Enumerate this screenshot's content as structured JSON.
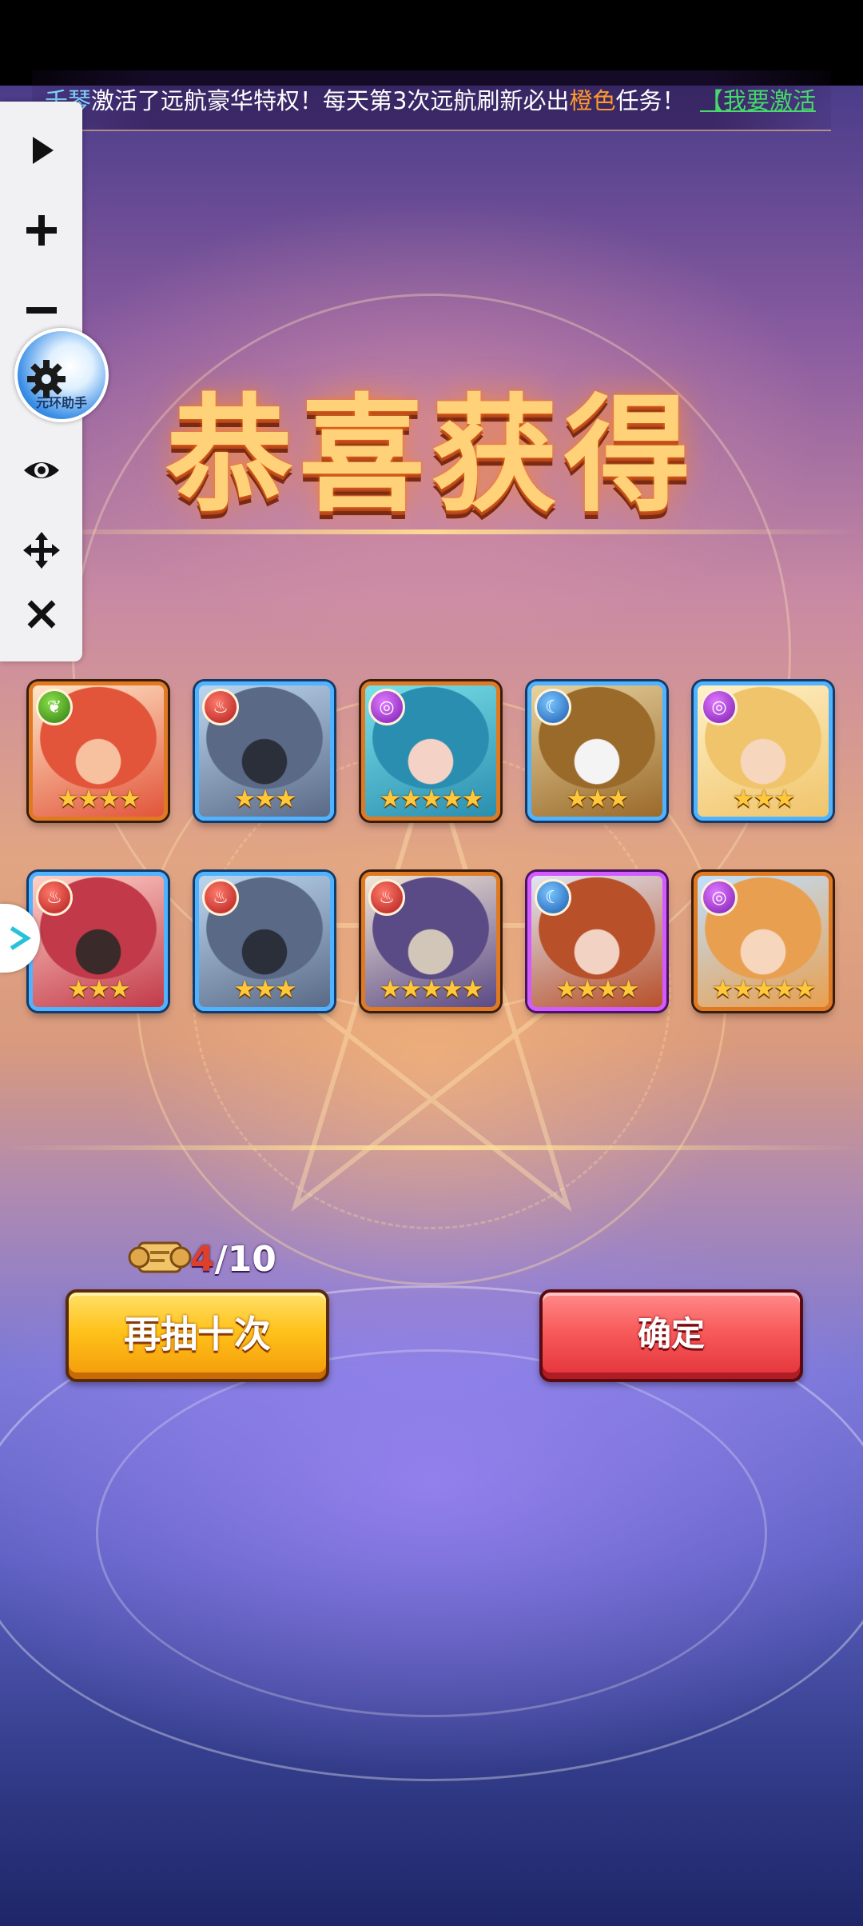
{
  "announcement": {
    "player_name": "千琴",
    "text_part1": "激活了远航豪华特权！每天第3次远航刷新必出",
    "highlight": "橙色",
    "text_part2": "任务！",
    "link_text": "【我要激活"
  },
  "title": "恭喜获得",
  "heroes": [
    {
      "faction": "nature",
      "faction_icon": "leaf-faction-icon",
      "frame": "orange",
      "stars": "★★★★",
      "star_count": 4,
      "portrait": "red-haired-heroine"
    },
    {
      "faction": "fire",
      "faction_icon": "flame-faction-icon",
      "frame": "blue",
      "stars": "★★★",
      "star_count": 3,
      "portrait": "grey-werewolf"
    },
    {
      "faction": "arcane",
      "faction_icon": "spiral-faction-icon",
      "frame": "orange",
      "stars": "★★★★★",
      "star_count": 5,
      "portrait": "teal-haired-heroine"
    },
    {
      "faction": "water",
      "faction_icon": "wave-faction-icon",
      "frame": "blue",
      "stars": "★★★",
      "star_count": 3,
      "portrait": "bearded-dwarf-warrior"
    },
    {
      "faction": "arcane",
      "faction_icon": "spiral-faction-icon",
      "frame": "blue",
      "stars": "★★★",
      "star_count": 3,
      "portrait": "blonde-heroine"
    },
    {
      "faction": "fire",
      "faction_icon": "flame-faction-icon",
      "frame": "blue",
      "stars": "★★★",
      "star_count": 3,
      "portrait": "pirate-heroine"
    },
    {
      "faction": "fire",
      "faction_icon": "flame-faction-icon",
      "frame": "blue",
      "stars": "★★★",
      "star_count": 3,
      "portrait": "grey-werewolf"
    },
    {
      "faction": "fire",
      "faction_icon": "flame-faction-icon",
      "frame": "orange",
      "stars": "★★★★★",
      "star_count": 5,
      "portrait": "white-haired-mage"
    },
    {
      "faction": "water",
      "faction_icon": "wave-faction-icon",
      "frame": "purple",
      "stars": "★★★★",
      "star_count": 4,
      "portrait": "auburn-haired-hero"
    },
    {
      "faction": "arcane",
      "faction_icon": "spiral-faction-icon",
      "frame": "orange",
      "stars": "★★★★★",
      "star_count": 5,
      "portrait": "hooded-ginger-heroine"
    }
  ],
  "summon_ticket": {
    "icon": "scroll-ticket-icon",
    "current": "4",
    "separator_total": "/10"
  },
  "buttons": {
    "redraw": "再抽十次",
    "confirm": "确定"
  },
  "toolbar": {
    "items": [
      "play-icon",
      "zoom-in-icon",
      "zoom-out-icon",
      "settings-icon",
      "eye-icon",
      "move-icon",
      "close-icon"
    ],
    "assistant_label": "元环助手"
  },
  "colors": {
    "orange_frame": "#e07a22",
    "blue_frame": "#4fb3ff",
    "purple_frame": "#d15bff",
    "redraw_button": "#ffc21a",
    "confirm_button": "#f85a5a",
    "star": "#ffc83a"
  }
}
